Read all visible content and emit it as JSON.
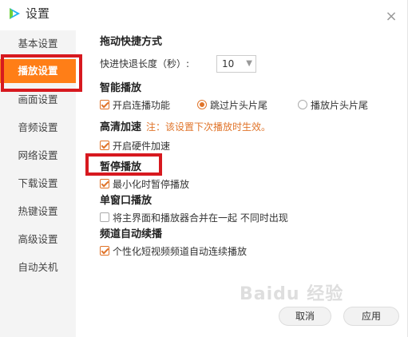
{
  "titlebar": {
    "title": "设置",
    "close_symbol": "×"
  },
  "sidebar": {
    "items": [
      {
        "label": "基本设置",
        "active": false
      },
      {
        "label": "播放设置",
        "active": true
      },
      {
        "label": "画面设置",
        "active": false
      },
      {
        "label": "音频设置",
        "active": false
      },
      {
        "label": "网络设置",
        "active": false
      },
      {
        "label": "下载设置",
        "active": false
      },
      {
        "label": "热键设置",
        "active": false
      },
      {
        "label": "高级设置",
        "active": false
      },
      {
        "label": "自动关机",
        "active": false
      }
    ]
  },
  "main": {
    "drag_shortcut": {
      "title": "拖动快捷方式",
      "seek_label": "快进快退长度（秒）:",
      "seek_value": "10"
    },
    "smart_play": {
      "title": "智能播放",
      "continuous_label": "开启连播功能",
      "skip_label": "跳过片头片尾",
      "play_label": "播放片头片尾"
    },
    "hd_accel": {
      "title": "高清加速",
      "note": "注：该设置下次播放时生效。",
      "hw_label": "开启硬件加速"
    },
    "pause_play": {
      "title": "暂停播放",
      "minimize_label": "最小化时暂停播放"
    },
    "single_window": {
      "title": "单窗口播放",
      "merge_label": "将主界面和播放器合并在一起 不同时出现"
    },
    "channel_auto": {
      "title": "频道自动续播",
      "personalize_label": "个性化短视频频道自动连续播放"
    }
  },
  "footer": {
    "cancel_label": "取消",
    "apply_label": "应用"
  },
  "watermark": "Baidu 经验",
  "colors": {
    "accent": "#ff7e17",
    "highlight": "#d7191f",
    "note": "#e0742a"
  }
}
